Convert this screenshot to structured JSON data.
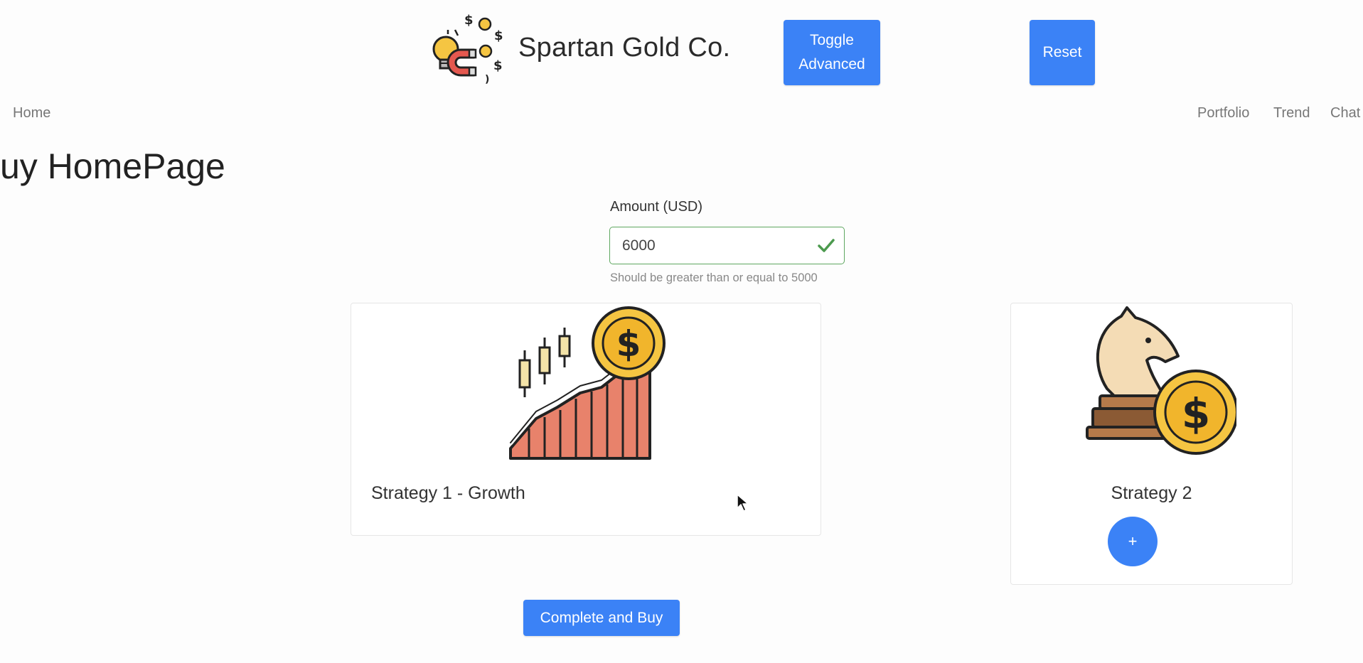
{
  "header": {
    "brand_name": "Spartan Gold Co.",
    "brand_logo_icon": "magnet-coins-lightbulb-icon",
    "toggle_label": "Toggle Advanced",
    "reset_label": "Reset"
  },
  "nav": {
    "home": "Home",
    "right_links": [
      "Portfolio",
      "Trend",
      "Chat"
    ]
  },
  "page": {
    "title": "uy HomePage"
  },
  "amount_field": {
    "label": "Amount (USD)",
    "value": "6000",
    "help_text": "Should be greater than or equal to 5000",
    "valid": true
  },
  "strategies": [
    {
      "title": "Strategy 1 - Growth",
      "icon": "candlestick-growth-coin-icon"
    },
    {
      "title": "Strategy 2",
      "icon": "chess-knight-coin-icon",
      "add_label": "+"
    }
  ],
  "actions": {
    "complete_label": "Complete and Buy"
  },
  "colors": {
    "primary": "#3b82f6",
    "valid_border": "#5ea760",
    "coin_yellow": "#f5c542",
    "bar_salmon": "#e8826b"
  }
}
